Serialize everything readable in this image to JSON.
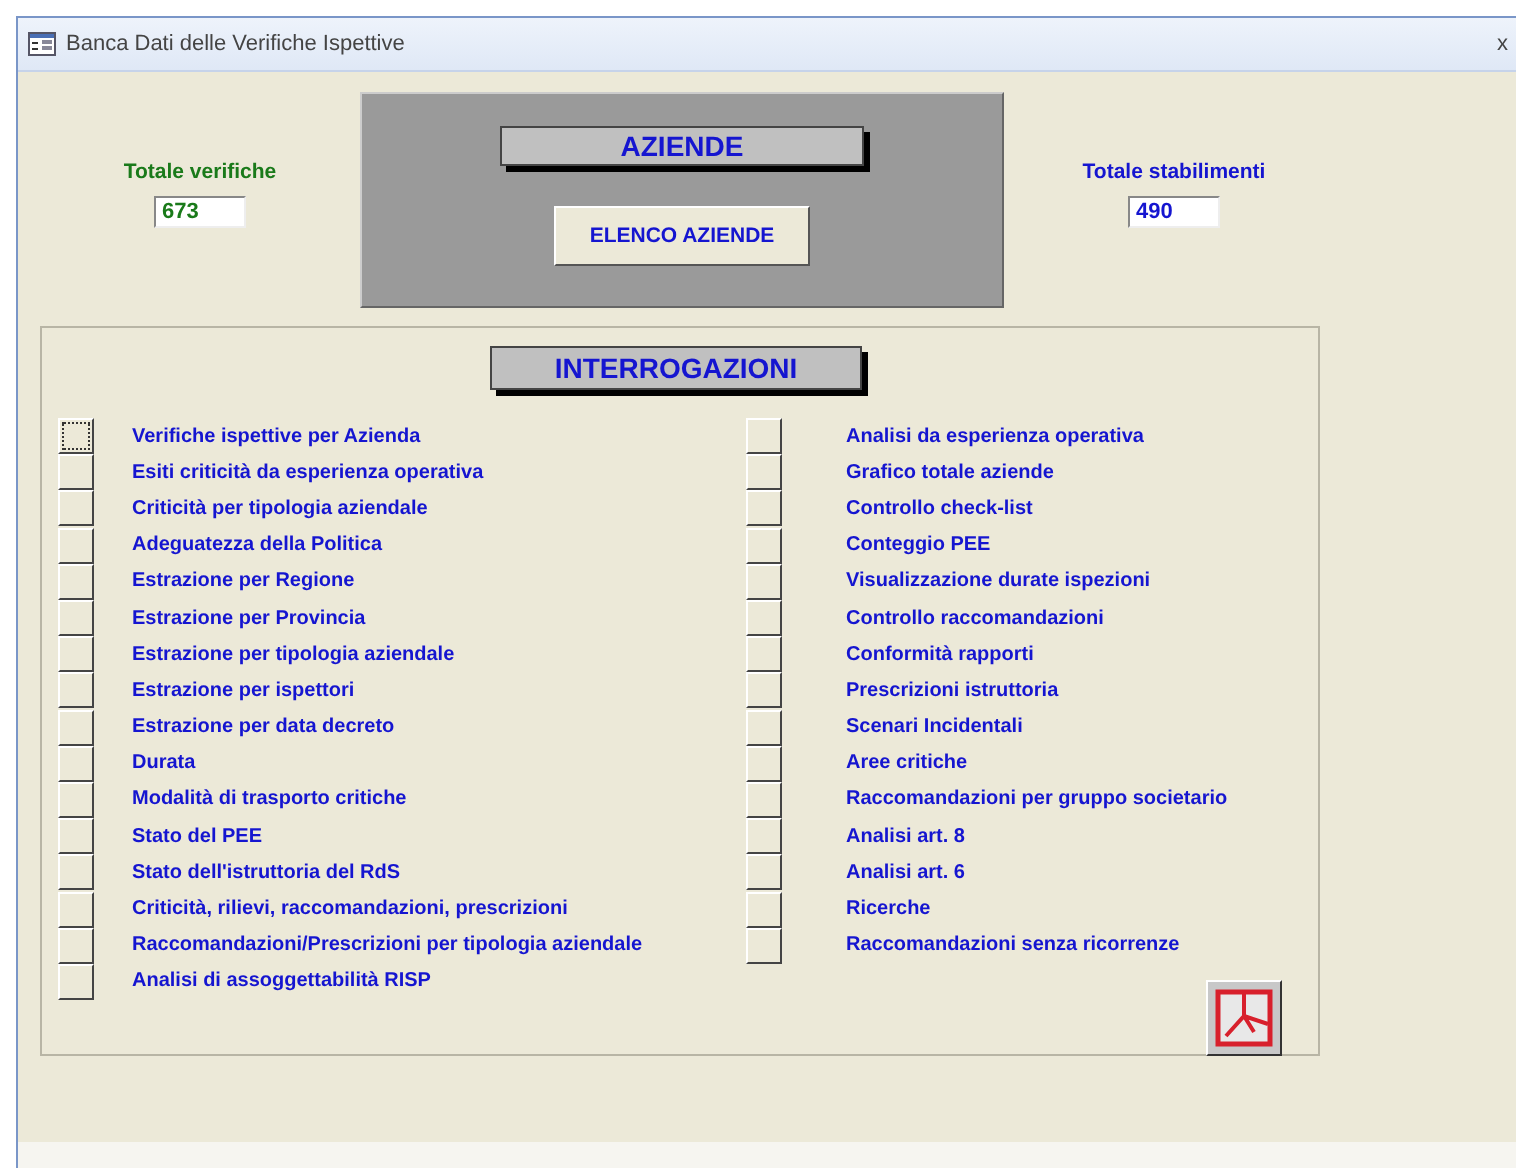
{
  "window": {
    "title": "Banca Dati delle Verifiche Ispettive",
    "close": "x"
  },
  "totale_verifiche": {
    "label": "Totale verifiche",
    "value": "673"
  },
  "aziende": {
    "heading": "AZIENDE",
    "button": "ELENCO AZIENDE"
  },
  "totale_stabilimenti": {
    "label": "Totale stabilimenti",
    "value": "490"
  },
  "interrogazioni": {
    "heading": "INTERROGAZIONI",
    "left": [
      {
        "label": "Verifiche ispettive per Azienda",
        "focused": true
      },
      {
        "label": "Esiti criticità da esperienza operativa",
        "focused": false
      },
      {
        "label": "Criticità per tipologia aziendale",
        "focused": false
      },
      {
        "label": "Adeguatezza della Politica",
        "focused": false
      },
      {
        "label": "Estrazione per Regione",
        "focused": false
      },
      {
        "label": "Estrazione per Provincia",
        "focused": false
      },
      {
        "label": "Estrazione per tipologia aziendale",
        "focused": false
      },
      {
        "label": "Estrazione per ispettori",
        "focused": false
      },
      {
        "label": "Estrazione per data decreto",
        "focused": false
      },
      {
        "label": "Durata",
        "focused": false
      },
      {
        "label": "Modalità di trasporto critiche",
        "focused": false
      },
      {
        "label": "Stato del PEE",
        "focused": false
      },
      {
        "label": "Stato dell'istruttoria del RdS",
        "focused": false
      },
      {
        "label": "Criticità, rilievi, raccomandazioni, prescrizioni",
        "focused": false
      },
      {
        "label": "Raccomandazioni/Prescrizioni per tipologia aziendale",
        "focused": false
      },
      {
        "label": "Analisi di assoggettabilità RISP",
        "focused": false
      }
    ],
    "right": [
      {
        "label": "Analisi da esperienza operativa",
        "focused": false
      },
      {
        "label": "Grafico totale aziende",
        "focused": false
      },
      {
        "label": "Controllo check-list",
        "focused": false
      },
      {
        "label": "Conteggio PEE",
        "focused": false
      },
      {
        "label": "Visualizzazione durate ispezioni",
        "focused": false
      },
      {
        "label": "Controllo raccomandazioni",
        "focused": false
      },
      {
        "label": "Conformità rapporti",
        "focused": false
      },
      {
        "label": "Prescrizioni istruttoria",
        "focused": false
      },
      {
        "label": "Scenari Incidentali",
        "focused": false
      },
      {
        "label": "Aree critiche",
        "focused": false
      },
      {
        "label": "Raccomandazioni per gruppo societario",
        "focused": false
      },
      {
        "label": "Analisi art. 8",
        "focused": false
      },
      {
        "label": "Analisi art. 6",
        "focused": false
      },
      {
        "label": "Ricerche",
        "focused": false
      },
      {
        "label": "Raccomandazioni senza ricorrenze",
        "focused": false
      }
    ]
  }
}
